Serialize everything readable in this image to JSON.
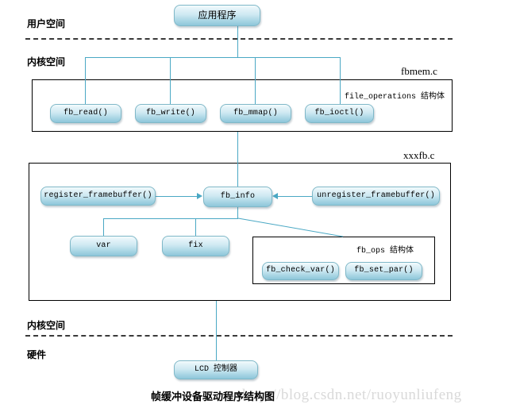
{
  "diagram": {
    "caption": "帧缓冲设备驱动程序结构图",
    "watermark": "http://blog.csdn.net/ruoyunliufeng",
    "accent_color": "#4aa8c4",
    "node_border_color": "#7fb8c8",
    "container_border_color": "#000000",
    "separator_color": "#3a3a3a"
  },
  "layers": {
    "user_space": "用户空间",
    "kernel_space_top": "内核空间",
    "kernel_space_bottom": "内核空间",
    "hardware": "硬件"
  },
  "files": {
    "fbmem": "fbmem.c",
    "xxxfb": "xxxfb.c"
  },
  "structs": {
    "file_operations": "file_operations 结构体",
    "fb_ops": "fb_ops 结构体"
  },
  "nodes": {
    "application": "应用程序",
    "fb_read": "fb_read()",
    "fb_write": "fb_write()",
    "fb_mmap": "fb_mmap()",
    "fb_ioctl": "fb_ioctl()",
    "register_framebuffer": "register_framebuffer()",
    "fb_info": "fb_info",
    "unregister_framebuffer": "unregister_framebuffer()",
    "var": "var",
    "fix": "fix",
    "fb_check_var": "fb_check_var()",
    "fb_set_par": "fb_set_par()",
    "lcd_controller": "LCD 控制器"
  }
}
